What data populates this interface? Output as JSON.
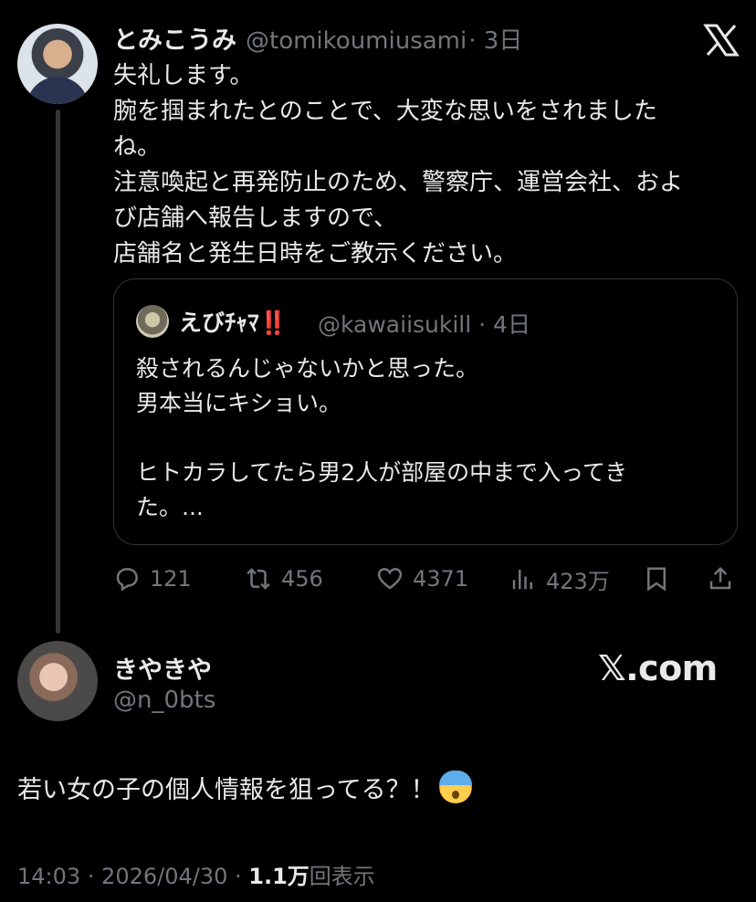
{
  "original_tweet": {
    "name": "とみこうみ",
    "handle": "@tomikoumiusami",
    "time": "· 3日",
    "text": "失礼します。\n腕を掴まれたとのことで、大変な思いをされました\nね。\n注意喚起と再発防止のため、警察庁、運営会社、およ\nび店舗へ報告しますので、\n店舗名と発生日時をご教示ください。",
    "quote": {
      "name": "えびﾁｬﾏ‼️",
      "handle": "@kawaiisukill",
      "time": "· 4日",
      "text": "殺されるんじゃないかと思った。\n男本当にキショい。\n\nヒトカラしてたら男2人が部屋の中まで入ってき\nた。..."
    },
    "actions": {
      "replies": "121",
      "reposts": "456",
      "likes": "4371",
      "views": "423万"
    }
  },
  "reply": {
    "name": "きやきや",
    "handle": "@n_0bts",
    "text": "若い女の子の個人情報を狙ってる？！",
    "emoji": "fearful-face-emoji",
    "time": "14:03 · 2026/04/30 · ",
    "views_count": "1.1万",
    "views_label": "回表示"
  },
  "watermark": "𝕏.com",
  "icons": {
    "x_logo": "x-logo-icon",
    "reply": "reply-icon",
    "repost": "repost-icon",
    "like": "heart-icon",
    "views": "views-icon",
    "bookmark": "bookmark-icon",
    "share": "share-icon"
  },
  "colors": {
    "background": "#000000",
    "text": "#e7e9ea",
    "secondary": "#71767b",
    "border": "#2f3336"
  }
}
